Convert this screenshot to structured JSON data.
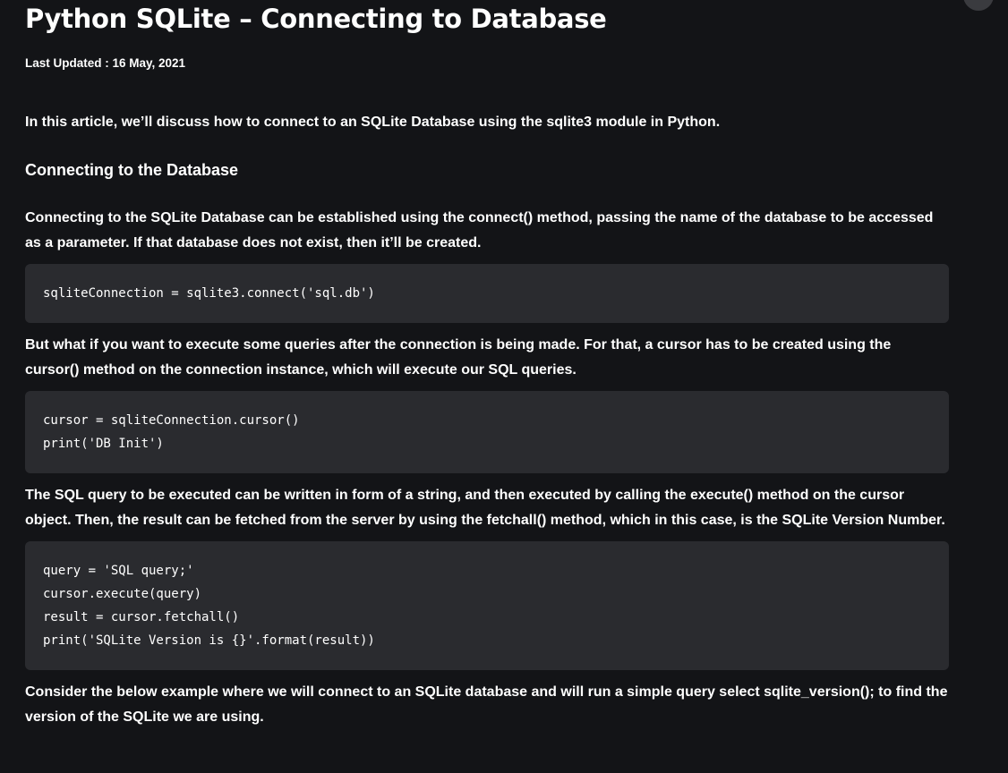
{
  "article": {
    "title": "Python SQLite – Connecting to Database",
    "last_updated": "Last Updated : 16 May, 2021",
    "intro": "In this article, we’ll discuss how to connect to an SQLite Database using the sqlite3 module in Python.",
    "section_heading": "Connecting to the Database",
    "para1": {
      "before": "Connecting to the SQLite Database can be established using the ",
      "bold": "connect()",
      "after": " method, passing the name of the database to be accessed as a parameter. If that database does not exist, then it’ll be created."
    },
    "code1": [
      "sqliteConnection = sqlite3.connect('sql.db')"
    ],
    "para2": {
      "before": "But what if you want to execute some queries after the connection is being made. For that, a cursor has to be created using the ",
      "bold": "cursor()",
      "after": " method on the connection instance, which will execute our SQL queries."
    },
    "code2": [
      "cursor = sqliteConnection.cursor()",
      "print('DB Init')"
    ],
    "para3": {
      "before": "The SQL query to be executed can be written in form of a string, and then executed by calling the ",
      "bold1": "execute()",
      "middle": " method on the cursor object. Then, the result can be fetched from the server by using the ",
      "bold2": "fetchall()",
      "after": " method, which in this case, is the SQLite Version Number."
    },
    "code3": [
      "query = 'SQL query;'",
      "cursor.execute(query)",
      "result = cursor.fetchall()",
      "print('SQLite Version is {}'.format(result))"
    ],
    "para4": "Consider the below example where we will connect to an SQLite database and will run a simple query select sqlite_version(); to find the version of the SQLite we are using."
  },
  "theme": {
    "background": "#131417",
    "code_background": "#2a2b2f",
    "text": "#ffffff"
  }
}
